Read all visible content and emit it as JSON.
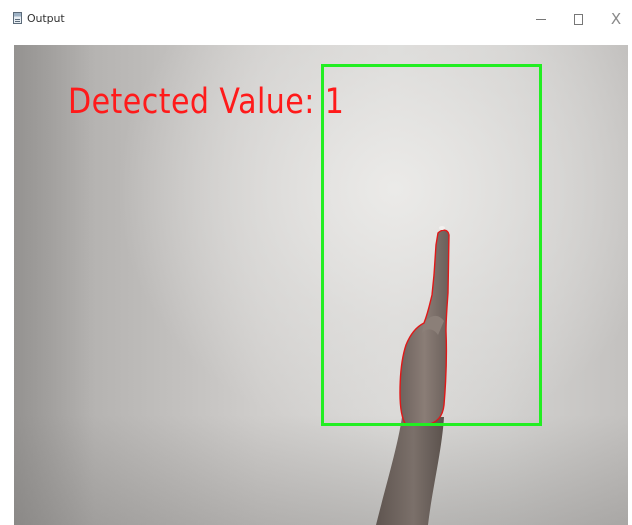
{
  "window": {
    "title": "Output",
    "icon": "app-window-icon",
    "controls": {
      "minimize_icon": "minimize-icon",
      "maximize_icon": "maximize-icon",
      "close_icon": "close-icon",
      "close_glyph": "X"
    }
  },
  "frame": {
    "detected_label": "Detected Value: 1",
    "label_color": "#ff1a1a",
    "box_color": "#22ee22",
    "contour_color": "#e01818"
  }
}
